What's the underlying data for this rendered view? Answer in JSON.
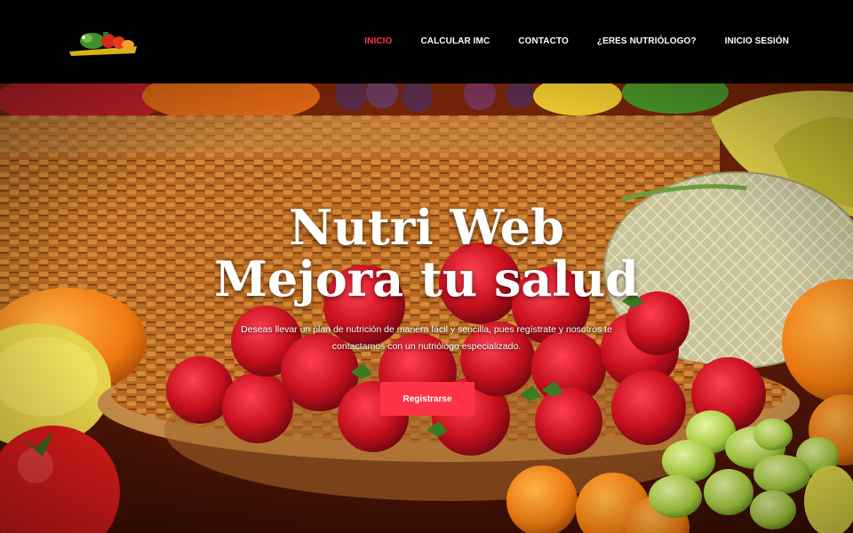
{
  "nav": {
    "items": [
      {
        "label": "INICIO",
        "active": true
      },
      {
        "label": "CALCULAR IMC",
        "active": false
      },
      {
        "label": "CONTACTO",
        "active": false
      },
      {
        "label": "¿ERES NUTRIÓLOGO?",
        "active": false
      },
      {
        "label": "INICIO SESIÓN",
        "active": false
      }
    ],
    "active_color": "#ff3b4e"
  },
  "hero": {
    "title_line1": "Nutri Web",
    "title_line2": "Mejora tu salud",
    "description": "Deseas llevar un plan de nutrición de manera fácil y sencilla, pues regístrate y nosotros te contactamos con un nutriólogo especializado.",
    "cta_label": "Registrarse",
    "cta_color": "#ff3346"
  }
}
